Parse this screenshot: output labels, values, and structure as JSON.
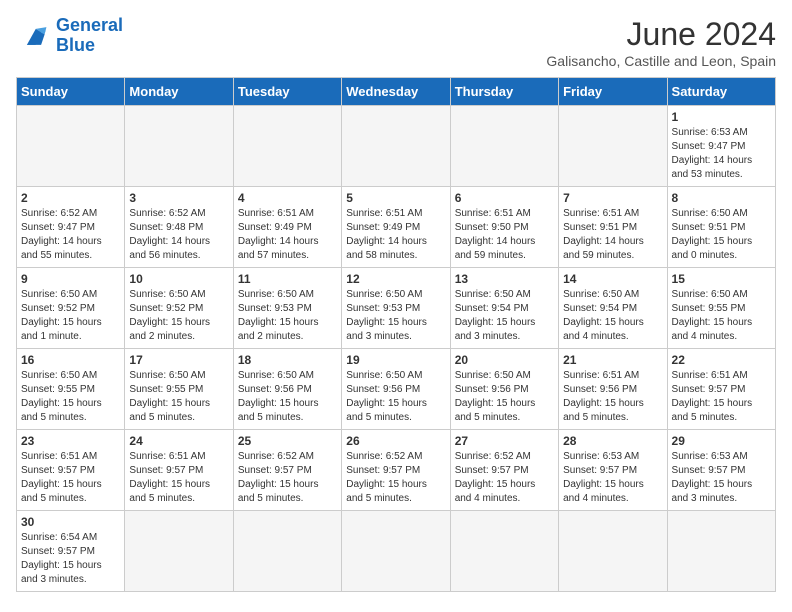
{
  "header": {
    "logo_line1": "General",
    "logo_line2": "Blue",
    "title": "June 2024",
    "subtitle": "Galisancho, Castille and Leon, Spain"
  },
  "weekdays": [
    "Sunday",
    "Monday",
    "Tuesday",
    "Wednesday",
    "Thursday",
    "Friday",
    "Saturday"
  ],
  "weeks": [
    [
      {
        "day": "",
        "info": ""
      },
      {
        "day": "",
        "info": ""
      },
      {
        "day": "",
        "info": ""
      },
      {
        "day": "",
        "info": ""
      },
      {
        "day": "",
        "info": ""
      },
      {
        "day": "",
        "info": ""
      },
      {
        "day": "1",
        "info": "Sunrise: 6:53 AM\nSunset: 9:47 PM\nDaylight: 14 hours\nand 53 minutes."
      }
    ],
    [
      {
        "day": "2",
        "info": "Sunrise: 6:52 AM\nSunset: 9:47 PM\nDaylight: 14 hours\nand 55 minutes."
      },
      {
        "day": "3",
        "info": "Sunrise: 6:52 AM\nSunset: 9:48 PM\nDaylight: 14 hours\nand 56 minutes."
      },
      {
        "day": "4",
        "info": "Sunrise: 6:51 AM\nSunset: 9:49 PM\nDaylight: 14 hours\nand 57 minutes."
      },
      {
        "day": "5",
        "info": "Sunrise: 6:51 AM\nSunset: 9:49 PM\nDaylight: 14 hours\nand 58 minutes."
      },
      {
        "day": "6",
        "info": "Sunrise: 6:51 AM\nSunset: 9:50 PM\nDaylight: 14 hours\nand 59 minutes."
      },
      {
        "day": "7",
        "info": "Sunrise: 6:51 AM\nSunset: 9:51 PM\nDaylight: 14 hours\nand 59 minutes."
      },
      {
        "day": "8",
        "info": "Sunrise: 6:50 AM\nSunset: 9:51 PM\nDaylight: 15 hours\nand 0 minutes."
      }
    ],
    [
      {
        "day": "9",
        "info": "Sunrise: 6:50 AM\nSunset: 9:52 PM\nDaylight: 15 hours\nand 1 minute."
      },
      {
        "day": "10",
        "info": "Sunrise: 6:50 AM\nSunset: 9:52 PM\nDaylight: 15 hours\nand 2 minutes."
      },
      {
        "day": "11",
        "info": "Sunrise: 6:50 AM\nSunset: 9:53 PM\nDaylight: 15 hours\nand 2 minutes."
      },
      {
        "day": "12",
        "info": "Sunrise: 6:50 AM\nSunset: 9:53 PM\nDaylight: 15 hours\nand 3 minutes."
      },
      {
        "day": "13",
        "info": "Sunrise: 6:50 AM\nSunset: 9:54 PM\nDaylight: 15 hours\nand 3 minutes."
      },
      {
        "day": "14",
        "info": "Sunrise: 6:50 AM\nSunset: 9:54 PM\nDaylight: 15 hours\nand 4 minutes."
      },
      {
        "day": "15",
        "info": "Sunrise: 6:50 AM\nSunset: 9:55 PM\nDaylight: 15 hours\nand 4 minutes."
      }
    ],
    [
      {
        "day": "16",
        "info": "Sunrise: 6:50 AM\nSunset: 9:55 PM\nDaylight: 15 hours\nand 5 minutes."
      },
      {
        "day": "17",
        "info": "Sunrise: 6:50 AM\nSunset: 9:55 PM\nDaylight: 15 hours\nand 5 minutes."
      },
      {
        "day": "18",
        "info": "Sunrise: 6:50 AM\nSunset: 9:56 PM\nDaylight: 15 hours\nand 5 minutes."
      },
      {
        "day": "19",
        "info": "Sunrise: 6:50 AM\nSunset: 9:56 PM\nDaylight: 15 hours\nand 5 minutes."
      },
      {
        "day": "20",
        "info": "Sunrise: 6:50 AM\nSunset: 9:56 PM\nDaylight: 15 hours\nand 5 minutes."
      },
      {
        "day": "21",
        "info": "Sunrise: 6:51 AM\nSunset: 9:56 PM\nDaylight: 15 hours\nand 5 minutes."
      },
      {
        "day": "22",
        "info": "Sunrise: 6:51 AM\nSunset: 9:57 PM\nDaylight: 15 hours\nand 5 minutes."
      }
    ],
    [
      {
        "day": "23",
        "info": "Sunrise: 6:51 AM\nSunset: 9:57 PM\nDaylight: 15 hours\nand 5 minutes."
      },
      {
        "day": "24",
        "info": "Sunrise: 6:51 AM\nSunset: 9:57 PM\nDaylight: 15 hours\nand 5 minutes."
      },
      {
        "day": "25",
        "info": "Sunrise: 6:52 AM\nSunset: 9:57 PM\nDaylight: 15 hours\nand 5 minutes."
      },
      {
        "day": "26",
        "info": "Sunrise: 6:52 AM\nSunset: 9:57 PM\nDaylight: 15 hours\nand 5 minutes."
      },
      {
        "day": "27",
        "info": "Sunrise: 6:52 AM\nSunset: 9:57 PM\nDaylight: 15 hours\nand 4 minutes."
      },
      {
        "day": "28",
        "info": "Sunrise: 6:53 AM\nSunset: 9:57 PM\nDaylight: 15 hours\nand 4 minutes."
      },
      {
        "day": "29",
        "info": "Sunrise: 6:53 AM\nSunset: 9:57 PM\nDaylight: 15 hours\nand 3 minutes."
      }
    ],
    [
      {
        "day": "30",
        "info": "Sunrise: 6:54 AM\nSunset: 9:57 PM\nDaylight: 15 hours\nand 3 minutes."
      },
      {
        "day": "",
        "info": ""
      },
      {
        "day": "",
        "info": ""
      },
      {
        "day": "",
        "info": ""
      },
      {
        "day": "",
        "info": ""
      },
      {
        "day": "",
        "info": ""
      },
      {
        "day": "",
        "info": ""
      }
    ]
  ]
}
